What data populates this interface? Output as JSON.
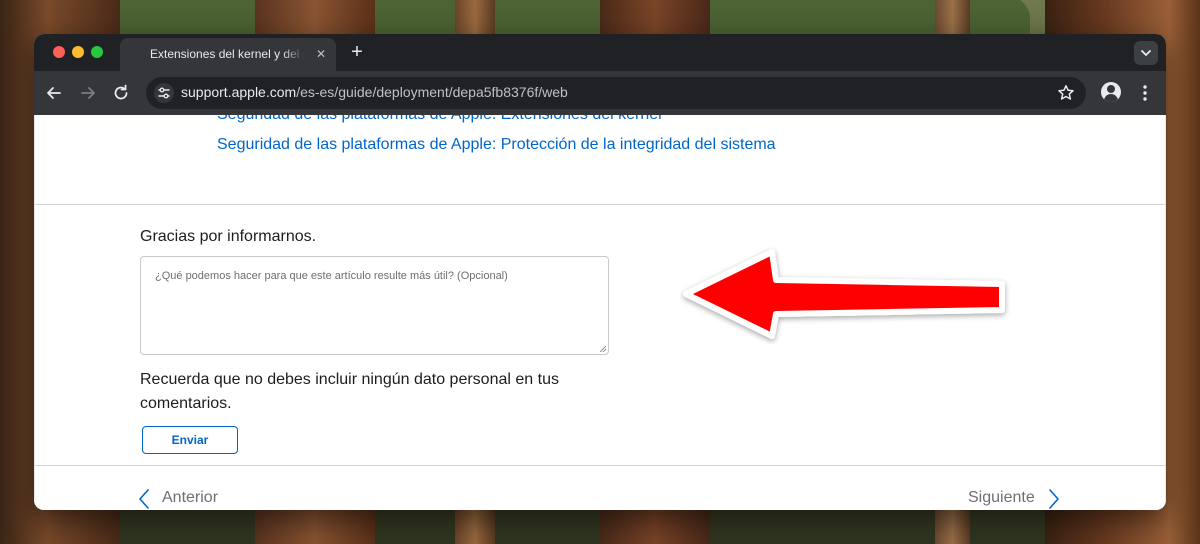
{
  "browser": {
    "tab_title": "Extensiones del kernel y del s",
    "tab_close": "✕",
    "new_tab": "+",
    "url_host": "support.apple.com",
    "url_path": "/es-es/guide/deployment/depa5fb8376f/web"
  },
  "page": {
    "links": [
      "Seguridad de las plataformas de Apple: Extensiones del kernel",
      "Seguridad de las plataformas de Apple: Protección de la integridad del sistema"
    ],
    "thanks": "Gracias por informarnos.",
    "feedback_placeholder": "¿Qué podemos hacer para que este artículo resulte más útil? (Opcional)",
    "note": "Recuerda que no debes incluir ningún dato personal en tus comentarios.",
    "send_label": "Enviar",
    "prev_label": "Anterior",
    "next_label": "Siguiente"
  },
  "colors": {
    "link": "#0066cc",
    "annotation_arrow": "#ff0000"
  }
}
